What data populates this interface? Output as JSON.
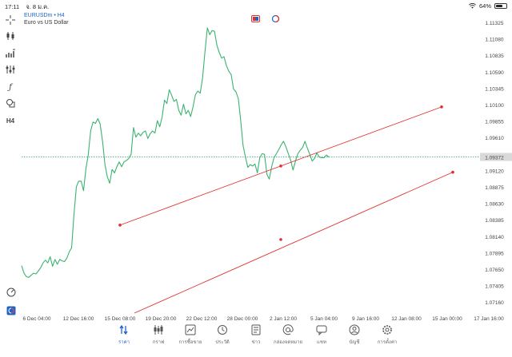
{
  "status_bar": {
    "time": "17:11",
    "date": "จ. 8 ม.ค.",
    "battery": "64%",
    "battery_level": 0.64
  },
  "symbol": {
    "name": "EURUSDm • H4",
    "description": "Euro vs US Dollar"
  },
  "price_axis": {
    "labels": [
      "1.11325",
      "1.11080",
      "1.10835",
      "1.10590",
      "1.10345",
      "1.10100",
      "1.09855",
      "1.09610",
      "1.09372",
      "1.09120",
      "1.08875",
      "1.08630",
      "1.08385",
      "1.08140",
      "1.07895",
      "1.07650",
      "1.07405",
      "1.07160"
    ],
    "current_price": "1.09372"
  },
  "time_axis": {
    "labels": [
      "6 Dec 04:00",
      "12 Dec 16:00",
      "15 Dec 08:00",
      "19 Dec 20:00",
      "22 Dec 12:00",
      "28 Dec 00:00",
      "2 Jan 12:00",
      "5 Jan 04:00",
      "9 Jan 16:00",
      "12 Jan 08:00",
      "15 Jan 00:00",
      "17 Jan 16:00"
    ]
  },
  "toolbar_left": {
    "timeframe": "H4",
    "tools": [
      "crosshair-icon",
      "candle-type-icon",
      "indicators-icon",
      "objects-icon",
      "function-icon",
      "shapes-icon",
      "timeframe-label"
    ]
  },
  "colors": {
    "price_line": "#3cb371",
    "channel_line": "#e0302e",
    "current_price_line": "#2e9e5a",
    "current_price_badge": "#d9d9d9",
    "accent": "#1e64c8"
  },
  "chart_data": {
    "type": "line",
    "series": [
      {
        "values": [
          1.0779,
          1.0768,
          1.0763,
          1.0762,
          1.0765,
          1.0768,
          1.0767,
          1.0771,
          1.0776,
          1.0783,
          1.0787,
          1.0783,
          1.0792,
          1.0778,
          1.0788,
          1.0781,
          1.0788,
          1.0786,
          1.0785,
          1.079,
          1.0799,
          1.0805,
          1.0854,
          1.0894,
          1.0902,
          1.0902,
          1.0888,
          1.092,
          1.094,
          1.0975,
          1.0988,
          1.0986,
          1.0993,
          1.0985,
          1.096,
          1.0926,
          1.0908,
          1.0899,
          1.0919,
          1.0914,
          1.0923,
          1.093,
          1.0923,
          1.093,
          1.0932,
          1.0935,
          1.0941,
          1.098,
          1.0966,
          1.0972,
          1.0968,
          1.0973,
          1.0975,
          1.0964,
          1.0971,
          1.0975,
          1.0972,
          1.099,
          1.0981,
          1.0995,
          1.102,
          1.1015,
          1.1035,
          1.1027,
          1.1018,
          1.1021,
          1.1005,
          1.0998,
          1.1014,
          1.1,
          1.1005,
          1.0996,
          1.101,
          1.1028,
          1.1033,
          1.103,
          1.1052,
          1.109,
          1.1125,
          1.1115,
          1.1121,
          1.112,
          1.11,
          1.1089,
          1.1081,
          1.1083,
          1.107,
          1.1062,
          1.1057,
          1.1036,
          1.1032,
          1.1022,
          1.099,
          1.0954,
          1.0937,
          1.0922,
          1.0926,
          1.0924,
          1.0927,
          1.0914,
          1.0936,
          1.0942,
          1.0941,
          1.0912,
          1.0905,
          1.0923,
          1.0936,
          1.0942,
          1.0948,
          1.0955,
          1.096,
          1.0952,
          1.0942,
          1.0932,
          1.0918,
          1.0931,
          1.0942,
          1.0947,
          1.0951,
          1.096,
          1.095,
          1.0941,
          1.0931,
          1.0935,
          1.0943,
          1.0937,
          1.0936,
          1.0936,
          1.094,
          1.0937
        ],
        "xrange": [
          "6 Dec 04:00",
          "5 Jan 08:00"
        ]
      }
    ],
    "channel": {
      "upper_line": {
        "start": [
          "15 Dec 08:00",
          1.0838
        ],
        "end": [
          "15 Jan 00:00",
          1.101
        ]
      },
      "lower_line": {
        "start": [
          "15 Dec 08:00",
          1.071
        ],
        "end": [
          "15 Jan 16:00",
          1.0915
        ]
      },
      "mid_points": [
        [
          "2 Jan 12:00",
          1.0924
        ],
        [
          "2 Jan 12:00",
          1.0817
        ]
      ]
    },
    "current_price": 1.09372,
    "ylim": [
      1.071,
      1.114
    ],
    "grid": false
  },
  "bottom_nav": {
    "items": [
      {
        "label": "ราคา",
        "icon": "quotes-icon",
        "active": true
      },
      {
        "label": "กราฟ",
        "icon": "chart-icon",
        "active": false
      },
      {
        "label": "การซื้อขาย",
        "icon": "trade-icon",
        "active": false
      },
      {
        "label": "ประวัติ",
        "icon": "history-icon",
        "active": false
      },
      {
        "label": "ข่าว",
        "icon": "news-icon",
        "active": false
      },
      {
        "label": "กล่องจดหมาย",
        "icon": "mailbox-icon",
        "active": false
      },
      {
        "label": "แชท",
        "icon": "chat-icon",
        "active": false
      },
      {
        "label": "บัญชี",
        "icon": "account-icon",
        "active": false
      },
      {
        "label": "การตั้งค่า",
        "icon": "settings-icon",
        "active": false
      }
    ]
  }
}
